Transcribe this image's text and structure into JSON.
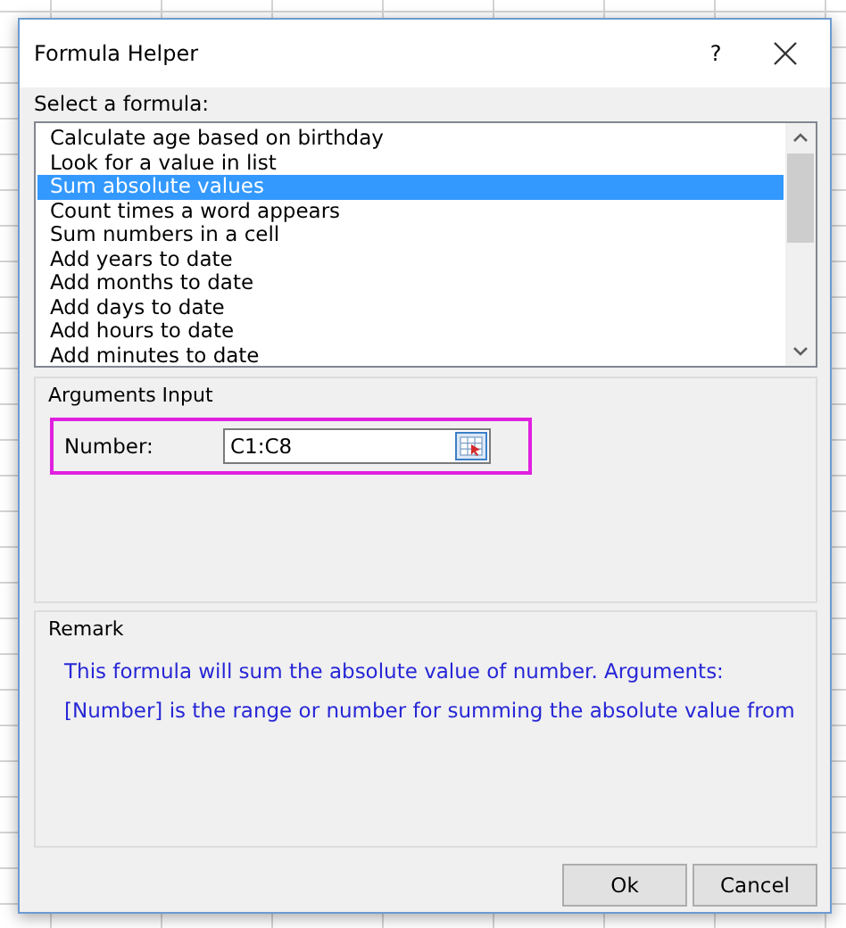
{
  "window": {
    "title": "Formula Helper",
    "help": "?"
  },
  "formula_list": {
    "label": "Select a formula:",
    "items": [
      {
        "label": "Calculate age based on birthday",
        "selected": false
      },
      {
        "label": "Look for a value in list",
        "selected": false
      },
      {
        "label": "Sum absolute values",
        "selected": true
      },
      {
        "label": "Count times a word appears",
        "selected": false
      },
      {
        "label": "Sum numbers in a cell",
        "selected": false
      },
      {
        "label": "Add years to date",
        "selected": false
      },
      {
        "label": "Add months to date",
        "selected": false
      },
      {
        "label": "Add days to date",
        "selected": false
      },
      {
        "label": "Add hours to date",
        "selected": false
      },
      {
        "label": "Add minutes to date",
        "selected": false
      }
    ]
  },
  "arguments": {
    "title": "Arguments Input",
    "fields": [
      {
        "label": "Number:",
        "value": "C1:C8",
        "highlighted": true
      }
    ]
  },
  "remark": {
    "title": "Remark",
    "lines": [
      "This formula will sum the absolute value of number. Arguments:",
      "[Number] is the range or number for summing the absolute value from"
    ]
  },
  "buttons": [
    "Ok",
    "Cancel"
  ]
}
